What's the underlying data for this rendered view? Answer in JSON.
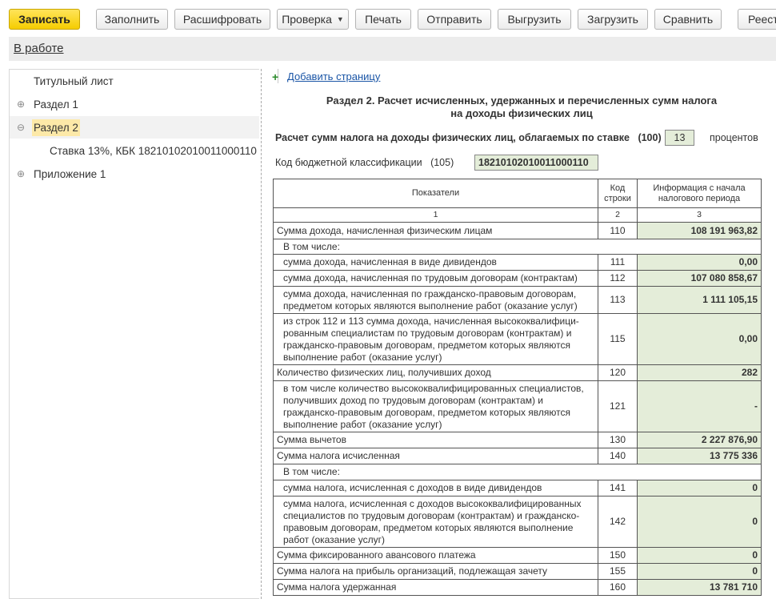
{
  "toolbar": {
    "buttons": [
      {
        "label": "Записать"
      },
      {
        "label": "Заполнить"
      },
      {
        "label": "Расшифровать"
      },
      {
        "label": "Проверка"
      },
      {
        "label": "Печать"
      },
      {
        "label": "Отправить"
      },
      {
        "label": "Выгрузить"
      },
      {
        "label": "Загрузить"
      },
      {
        "label": "Сравнить"
      },
      {
        "label": "Реест"
      }
    ]
  },
  "status": {
    "label": "В работе"
  },
  "tree": {
    "items": [
      {
        "label": "Титульный лист"
      },
      {
        "label": "Раздел 1",
        "expander": "⊕"
      },
      {
        "label": "Раздел 2",
        "expander": "⊖"
      },
      {
        "label": "Ставка 13%, КБК 18210102010011000110"
      },
      {
        "label": "Приложение 1",
        "expander": "⊕"
      }
    ]
  },
  "report": {
    "add_page": "Добавить страницу",
    "title_line1": "Раздел 2. Расчет исчисленных, удержанных и перечисленных сумм налога",
    "title_line2": "на доходы физических лиц",
    "rate_label": "Расчет сумм налога на доходы физических лиц, облагаемых по ставке",
    "rate_code": "(100)",
    "rate_value": "13",
    "rate_unit": "процентов",
    "kbk_label": "Код бюджетной классификации",
    "kbk_code": "(105)",
    "kbk_value": "18210102010011000110",
    "table": {
      "headers": {
        "indicators": "Показатели",
        "code": "Код строки",
        "info": "Информация с начала налогового периода"
      },
      "col_numbers": [
        "1",
        "2",
        "3"
      ],
      "rows": [
        {
          "label": "Сумма дохода, начисленная физическим лицам",
          "code": "110",
          "value": "108 191 963,82"
        },
        {
          "label": "В том числе:"
        },
        {
          "label": "сумма дохода, начисленная в виде дивидендов",
          "code": "111",
          "value": "0,00"
        },
        {
          "label": "сумма дохода, начисленная по трудовым договорам (контрактам)",
          "code": "112",
          "value": "107 080 858,67"
        },
        {
          "label": "сумма дохода, начисленная по гражданско-правовым договорам, предметом которых являются выполнение работ (оказание услуг)",
          "code": "113",
          "value": "1 111 105,15"
        },
        {
          "label": "из строк 112 и 113 сумма дохода, начисленная высококвалифици-рованным специалистам по трудовым договорам (контрактам) и гражданско-правовым договорам, предметом которых являются выполнение работ (оказание услуг)",
          "code": "115",
          "value": "0,00"
        },
        {
          "label": "Количество физических лиц, получивших доход",
          "code": "120",
          "value": "282"
        },
        {
          "label": "в том числе количество высококвалифицированных специалистов, получивших доход по трудовым договорам (контрактам) и гражданско-правовым договорам, предметом которых являются выполнение работ (оказание услуг)",
          "code": "121",
          "value": "-"
        },
        {
          "label": "Сумма вычетов",
          "code": "130",
          "value": "2 227 876,90"
        },
        {
          "label": "Сумма налога исчисленная",
          "code": "140",
          "value": "13 775 336"
        },
        {
          "label": "В том числе:"
        },
        {
          "label": "сумма налога, исчисленная с доходов в виде дивидендов",
          "code": "141",
          "value": "0"
        },
        {
          "label": "сумма налога, исчисленная с доходов высококвалифицированных специалистов по трудовым договорам (контрактам) и гражданско-правовым договорам, предметом которых являются выполнение работ (оказание услуг)",
          "code": "142",
          "value": "0"
        },
        {
          "label": "Сумма фиксированного авансового платежа",
          "code": "150",
          "value": "0"
        },
        {
          "label": "Сумма налога на прибыль организаций, подлежащая зачету",
          "code": "155",
          "value": "0"
        },
        {
          "label": "Сумма налога удержанная",
          "code": "160",
          "value": "13 781 710"
        }
      ]
    }
  }
}
